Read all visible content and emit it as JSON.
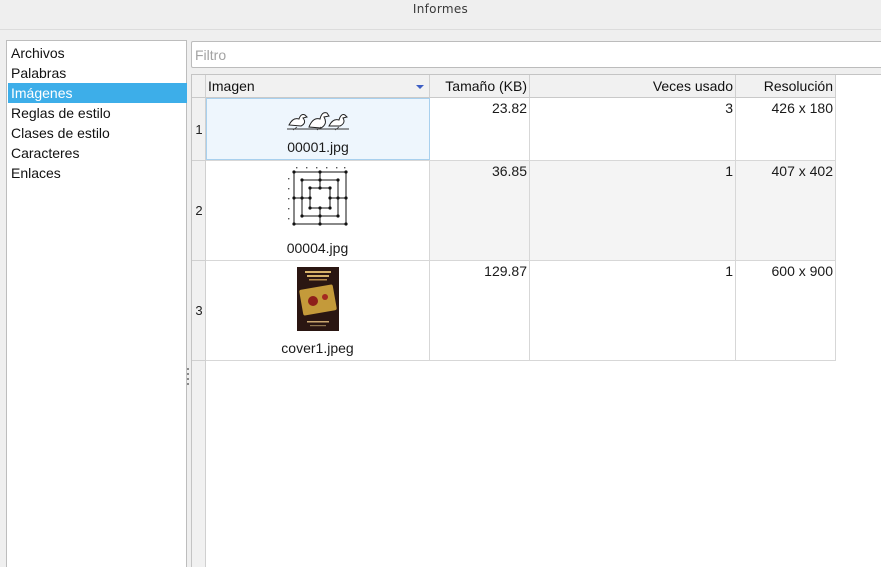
{
  "window": {
    "title": "Informes"
  },
  "sidebar": {
    "items": [
      {
        "label": "Archivos",
        "selected": false
      },
      {
        "label": "Palabras",
        "selected": false
      },
      {
        "label": "Imágenes",
        "selected": true
      },
      {
        "label": "Reglas de estilo",
        "selected": false
      },
      {
        "label": "Clases de estilo",
        "selected": false
      },
      {
        "label": "Caracteres",
        "selected": false
      },
      {
        "label": "Enlaces",
        "selected": false
      }
    ]
  },
  "filter": {
    "placeholder": "Filtro",
    "value": ""
  },
  "table": {
    "columns": [
      "Imagen",
      "Tamaño (KB)",
      "Veces usado",
      "Resolución"
    ],
    "sorted_column": "Imagen",
    "rows": [
      {
        "index": "1",
        "file": "00001.jpg",
        "thumb": "ducks-thumbnail",
        "size": "23.82",
        "used": "3",
        "resolution": "426 x 180"
      },
      {
        "index": "2",
        "file": "00004.jpg",
        "thumb": "grid-diagram-thumbnail",
        "size": "36.85",
        "used": "1",
        "resolution": "407 x 402"
      },
      {
        "index": "3",
        "file": "cover1.jpeg",
        "thumb": "book-cover-thumbnail",
        "size": "129.87",
        "used": "1",
        "resolution": "600 x 900"
      }
    ]
  },
  "colors": {
    "selection": "#3daee9",
    "sort_arrow": "#3d5ec4"
  }
}
